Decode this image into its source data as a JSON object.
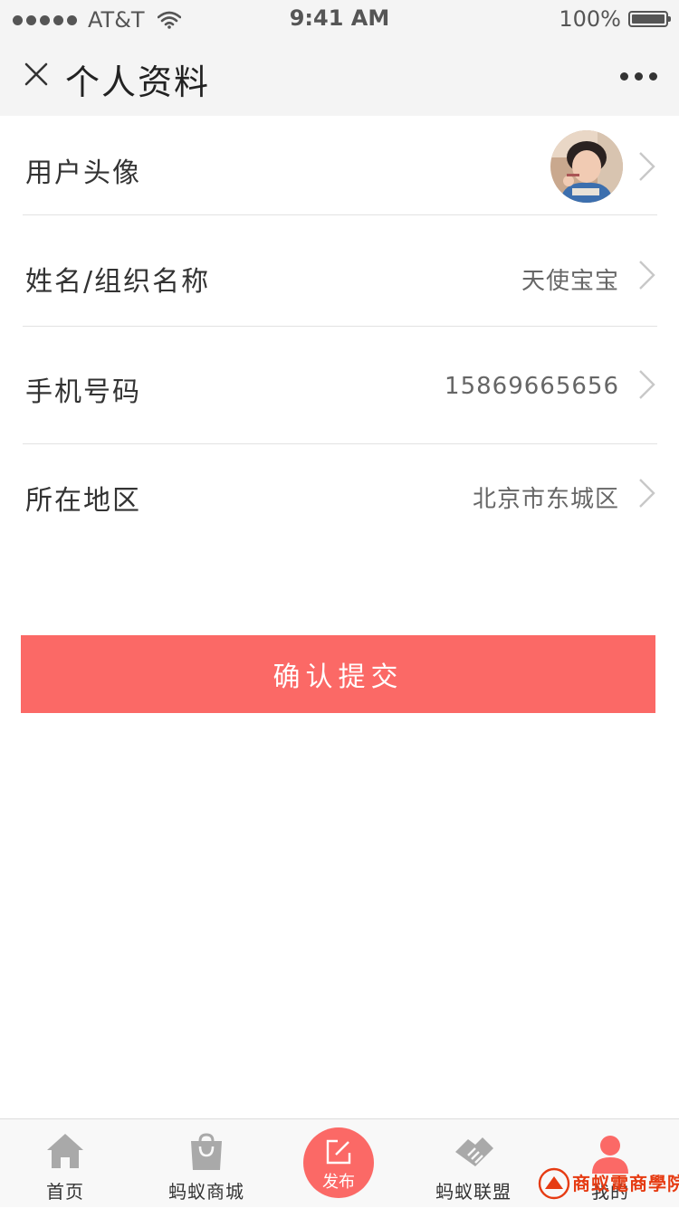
{
  "status_bar": {
    "carrier": "AT&T",
    "time": "9:41 AM",
    "battery": "100%"
  },
  "nav": {
    "title": "个人资料"
  },
  "profile": {
    "rows": [
      {
        "label": "用户头像",
        "value": ""
      },
      {
        "label": "姓名/组织名称",
        "value": "天使宝宝"
      },
      {
        "label": "手机号码",
        "value": "15869665656"
      },
      {
        "label": "所在地区",
        "value": "北京市东城区"
      }
    ]
  },
  "submit": {
    "label": "确认提交"
  },
  "tabs": [
    {
      "label": "首页",
      "icon": "home-icon"
    },
    {
      "label": "蚂蚁商城",
      "icon": "shopping-bag-icon"
    },
    {
      "label": "发布",
      "icon": "edit-icon"
    },
    {
      "label": "蚂蚁联盟",
      "icon": "handshake-icon"
    },
    {
      "label": "我的",
      "icon": "user-icon"
    }
  ],
  "watermark": {
    "text": "商蚁電商學院"
  },
  "colors": {
    "accent": "#fb6966",
    "bar_bg": "#f4f4f4"
  }
}
